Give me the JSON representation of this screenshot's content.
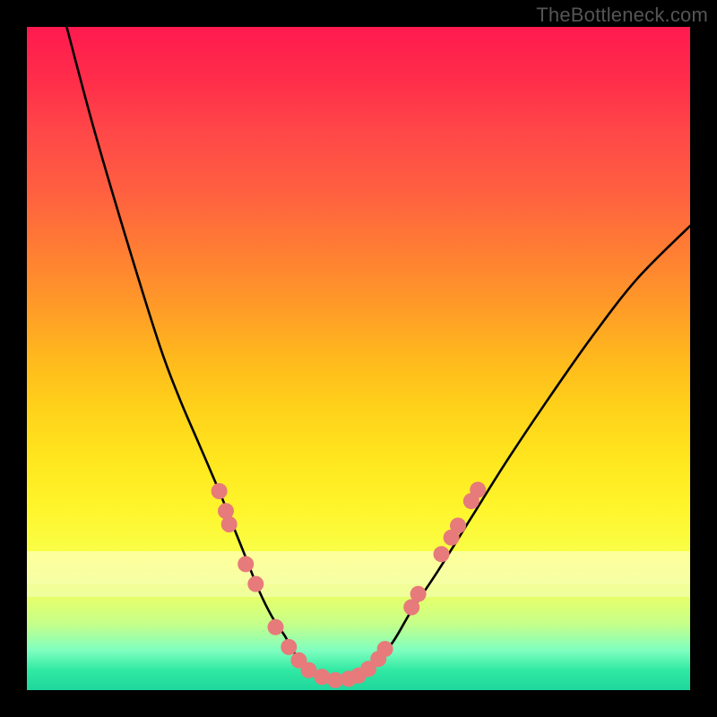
{
  "watermark": "TheBottleneck.com",
  "colors": {
    "frame_bg": "#000000",
    "gradient_top": "#ff1a4f",
    "gradient_bottom": "#1fd69c",
    "curve": "#000000",
    "dot_fill": "#e77a7a",
    "dot_stroke": "#cf5a5a"
  },
  "chart_data": {
    "type": "line",
    "title": "",
    "xlabel": "",
    "ylabel": "",
    "xlim": [
      0,
      100
    ],
    "ylim": [
      0,
      100
    ],
    "grid": false,
    "legend": false,
    "note": "Values are percentages of the plot area width (x) and height (y, 0 = top). Read off from pixel positions since no axes/ticks are drawn.",
    "series": [
      {
        "name": "bottleneck-curve",
        "x": [
          6,
          10,
          15,
          20,
          23,
          26,
          29,
          31,
          33,
          35,
          37,
          39,
          40,
          42,
          44,
          46,
          48,
          50,
          52,
          55,
          58,
          62,
          67,
          72,
          78,
          85,
          92,
          100
        ],
        "y": [
          0,
          15,
          32,
          48,
          56,
          63,
          70,
          75,
          80,
          85,
          89,
          92,
          94,
          96,
          97.5,
          98.3,
          98.3,
          97.5,
          96,
          93,
          88,
          82,
          74,
          66,
          57,
          47,
          38,
          30
        ]
      }
    ],
    "dots": [
      {
        "x": 29.0,
        "y": 70.0
      },
      {
        "x": 30.0,
        "y": 73.0
      },
      {
        "x": 30.5,
        "y": 75.0
      },
      {
        "x": 33.0,
        "y": 81.0
      },
      {
        "x": 34.5,
        "y": 84.0
      },
      {
        "x": 37.5,
        "y": 90.5
      },
      {
        "x": 39.5,
        "y": 93.5
      },
      {
        "x": 41.0,
        "y": 95.5
      },
      {
        "x": 42.5,
        "y": 97.0
      },
      {
        "x": 44.5,
        "y": 98.0
      },
      {
        "x": 46.5,
        "y": 98.5
      },
      {
        "x": 48.5,
        "y": 98.3
      },
      {
        "x": 50.0,
        "y": 97.8
      },
      {
        "x": 51.5,
        "y": 96.8
      },
      {
        "x": 53.0,
        "y": 95.3
      },
      {
        "x": 54.0,
        "y": 93.8
      },
      {
        "x": 58.0,
        "y": 87.5
      },
      {
        "x": 59.0,
        "y": 85.5
      },
      {
        "x": 62.5,
        "y": 79.5
      },
      {
        "x": 64.0,
        "y": 77.0
      },
      {
        "x": 65.0,
        "y": 75.2
      },
      {
        "x": 67.0,
        "y": 71.5
      },
      {
        "x": 68.0,
        "y": 69.8
      }
    ],
    "pale_bands": [
      {
        "top_pct": 79.0,
        "height_pct": 5.0,
        "color": "#ffffe0",
        "opacity": 0.55
      },
      {
        "top_pct": 84.0,
        "height_pct": 2.0,
        "color": "#ffffff",
        "opacity": 0.35
      }
    ]
  }
}
